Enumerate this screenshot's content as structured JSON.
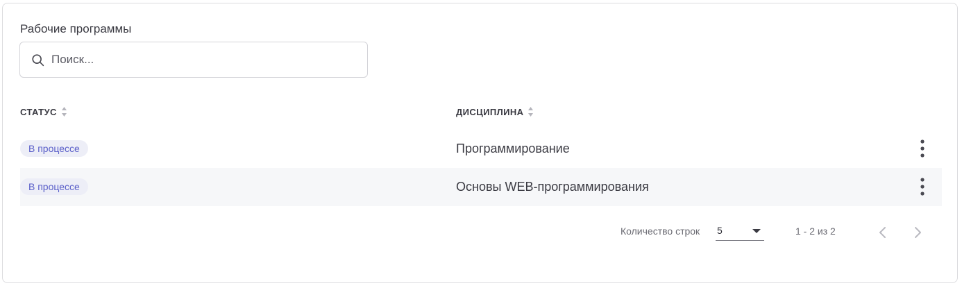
{
  "title": "Рабочие программы",
  "search": {
    "placeholder": "Поиск..."
  },
  "table": {
    "columns": [
      {
        "label": "СТАТУС"
      },
      {
        "label": "ДИСЦИПЛИНА"
      }
    ],
    "rows": [
      {
        "status": "В процессе",
        "discipline": "Программирование"
      },
      {
        "status": "В процессе",
        "discipline": "Основы WEB-программирования"
      }
    ]
  },
  "pagination": {
    "rows_label": "Количество строк",
    "rows_per_page": "5",
    "range_text": "1 - 2 из 2"
  },
  "colors": {
    "badge_bg": "#edeef7",
    "badge_text": "#5a5fc9",
    "row_alt_bg": "#f6f7f9"
  },
  "icons": [
    "search-icon",
    "sort-icon",
    "more-vertical-icon",
    "chevron-left-icon",
    "chevron-right-icon"
  ]
}
